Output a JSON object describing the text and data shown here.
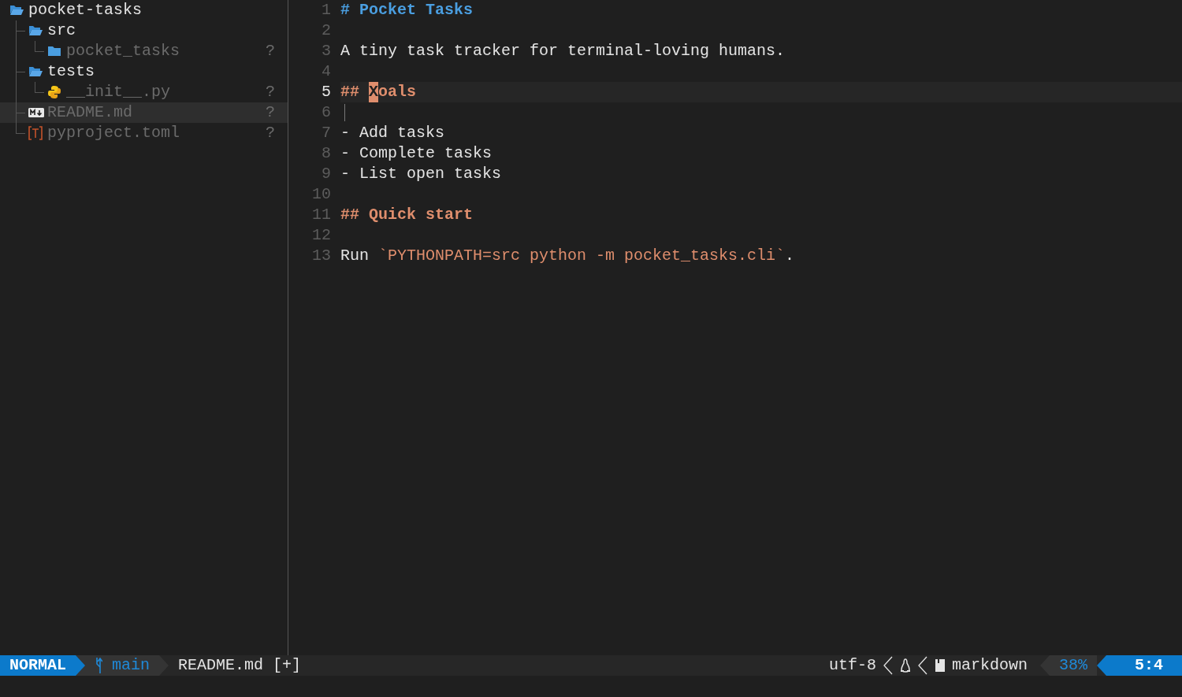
{
  "sidebar": {
    "tree": [
      {
        "name": "pocket-tasks",
        "kind": "folder",
        "expanded": true,
        "selected": false,
        "children": [
          {
            "name": "src",
            "kind": "folder",
            "expanded": true,
            "selected": false,
            "children": [
              {
                "name": "pocket_tasks",
                "kind": "folder",
                "expanded": false,
                "selected": false,
                "git_status": "?"
              }
            ]
          },
          {
            "name": "tests",
            "kind": "folder",
            "expanded": true,
            "selected": false,
            "children": [
              {
                "name": "__init__.py",
                "kind": "python",
                "selected": false,
                "git_status": "?"
              }
            ]
          },
          {
            "name": "README.md",
            "kind": "markdown",
            "selected": true,
            "git_status": "?"
          },
          {
            "name": "pyproject.toml",
            "kind": "toml",
            "selected": false,
            "git_status": "?"
          }
        ]
      }
    ]
  },
  "editor": {
    "lines": [
      {
        "number": "1",
        "current": false,
        "tokens": [
          {
            "text": "# Pocket Tasks",
            "kind": "heading1"
          }
        ]
      },
      {
        "number": "2",
        "current": false
      },
      {
        "number": "3",
        "current": false,
        "tokens": [
          {
            "text": "A tiny task tracker for terminal-loving humans.",
            "kind": "text"
          }
        ]
      },
      {
        "number": "4",
        "current": false
      },
      {
        "number": "5",
        "current": true,
        "tokens": [
          {
            "text": "## ",
            "kind": "heading2"
          },
          {
            "text": "X",
            "kind": "heading2",
            "cursor": true
          },
          {
            "text": "oals",
            "kind": "heading2"
          }
        ]
      },
      {
        "number": "6",
        "current": false,
        "guide": true
      },
      {
        "number": "7",
        "current": false,
        "tokens": [
          {
            "text": "- Add tasks",
            "kind": "text"
          }
        ]
      },
      {
        "number": "8",
        "current": false,
        "tokens": [
          {
            "text": "- Complete tasks",
            "kind": "text"
          }
        ]
      },
      {
        "number": "9",
        "current": false,
        "tokens": [
          {
            "text": "- List open tasks",
            "kind": "text"
          }
        ]
      },
      {
        "number": "10",
        "current": false
      },
      {
        "number": "11",
        "current": false,
        "tokens": [
          {
            "text": "## Quick start",
            "kind": "heading2"
          }
        ]
      },
      {
        "number": "12",
        "current": false
      },
      {
        "number": "13",
        "current": false,
        "tokens": [
          {
            "text": "Run ",
            "kind": "text"
          },
          {
            "text": "`PYTHONPATH=src python -m pocket_tasks.cli`",
            "kind": "code"
          },
          {
            "text": ".",
            "kind": "text"
          }
        ]
      }
    ]
  },
  "status_bar": {
    "mode": "NORMAL",
    "branch": "main",
    "file": "README.md",
    "modified": "[+]",
    "encoding": "utf-8",
    "filetype": "markdown",
    "progress": "38%",
    "position": "5:4"
  }
}
